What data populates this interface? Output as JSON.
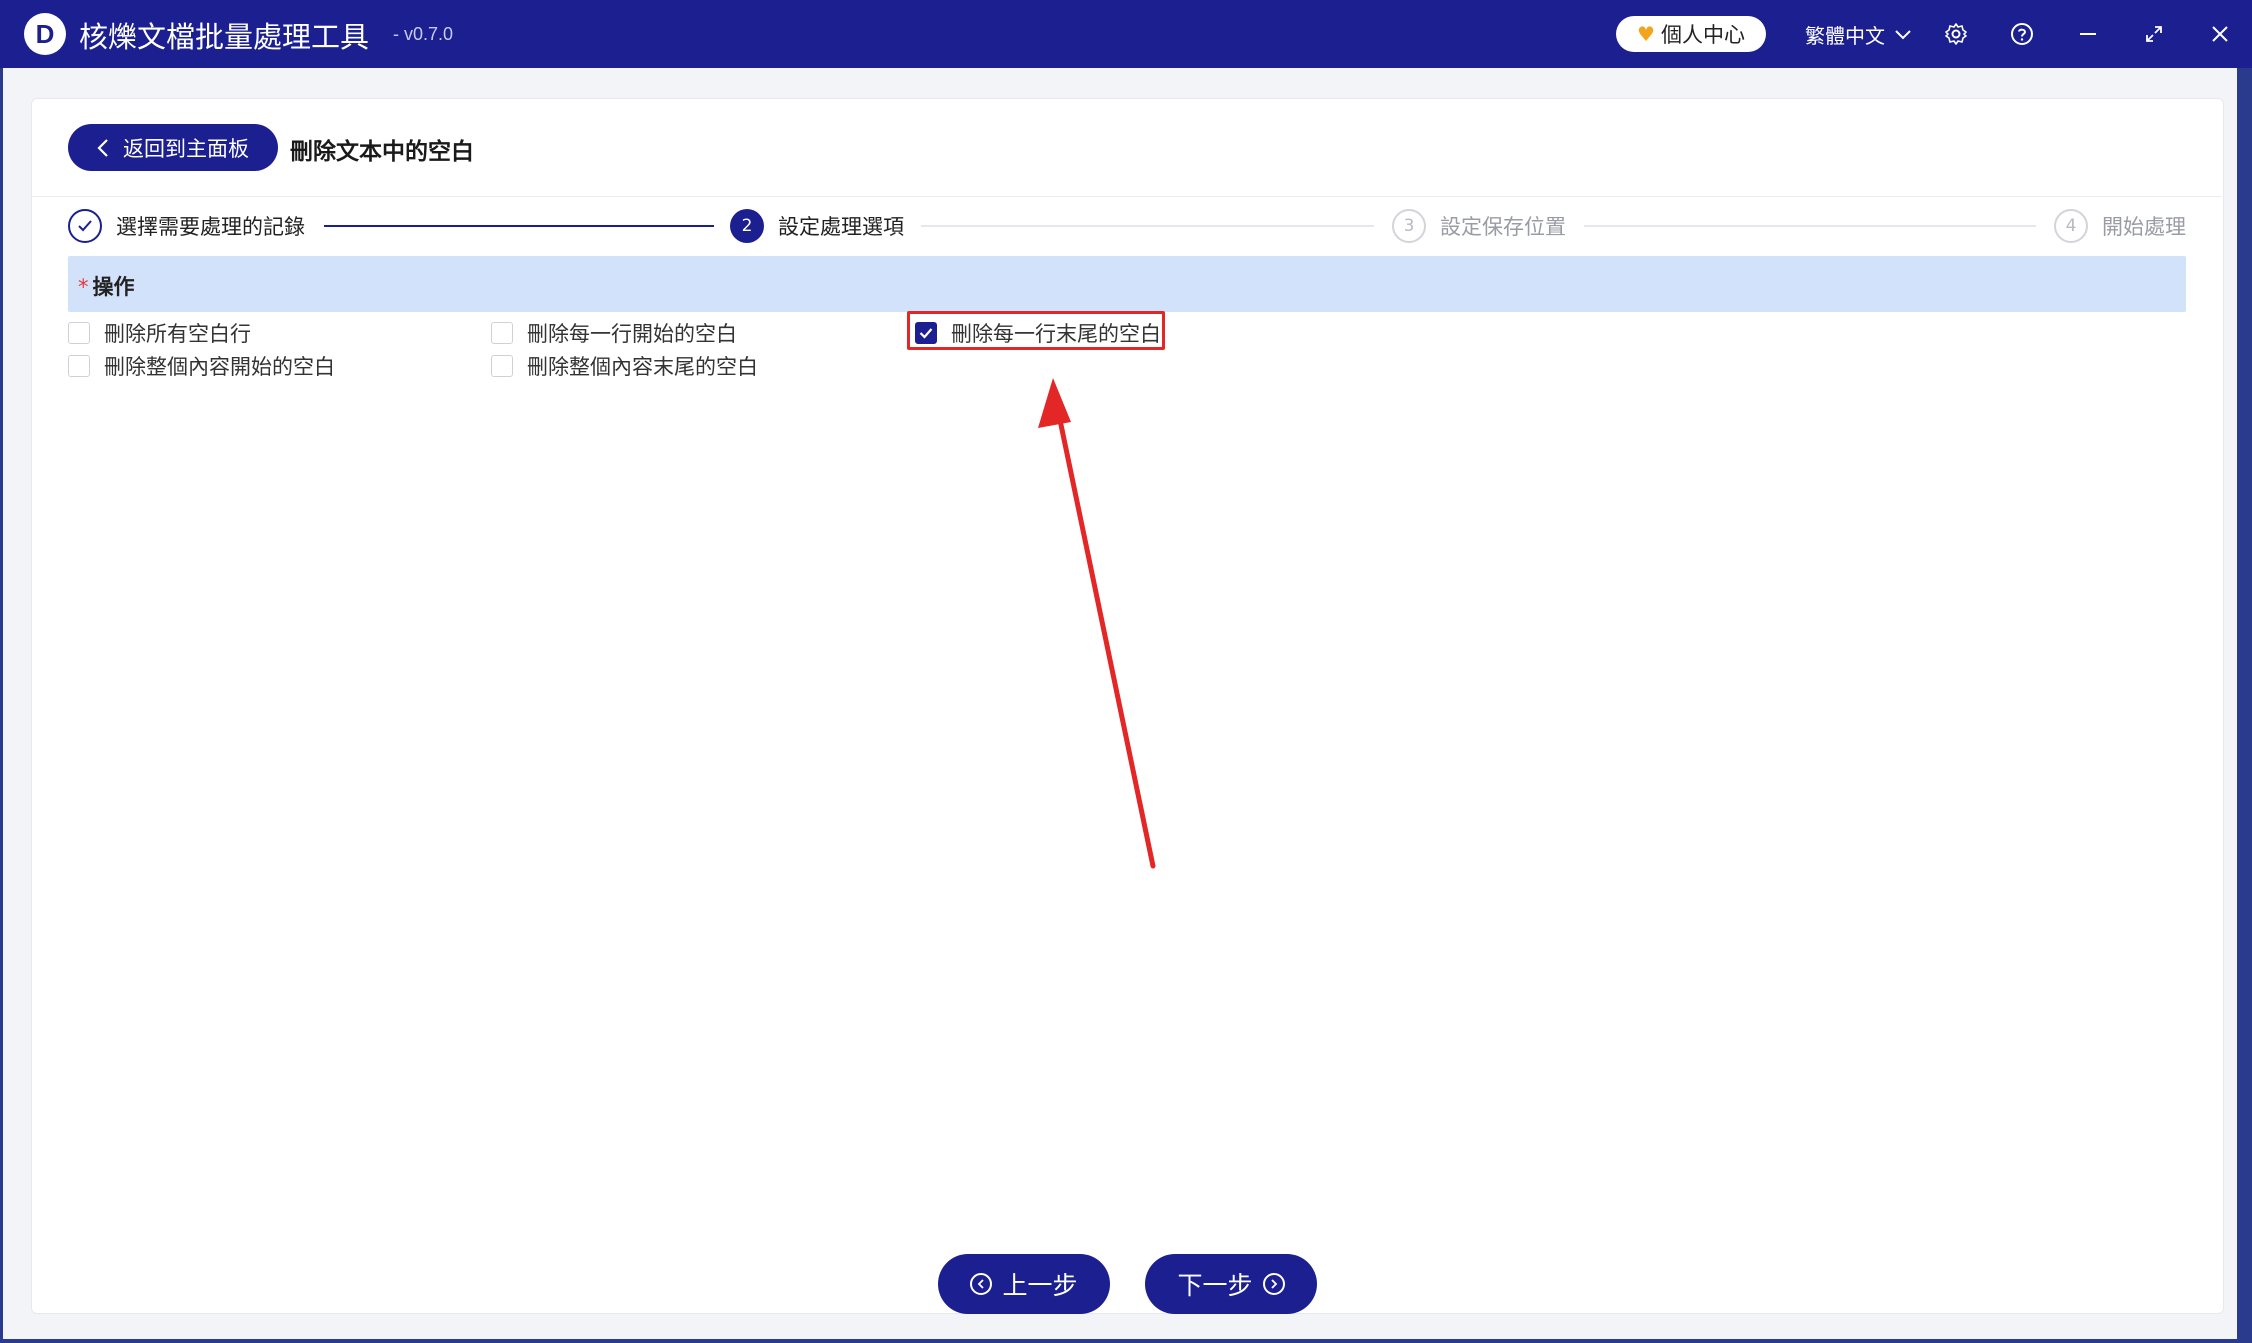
{
  "window": {
    "logo_letter": "D",
    "title": "核爍文檔批量處理工具",
    "version": "- v0.7.0",
    "vip_label": "個人中心",
    "language": "繁體中文",
    "icons": [
      "settings-icon",
      "help-icon",
      "minimize-icon",
      "maximize-icon",
      "close-icon"
    ]
  },
  "header": {
    "back_label": "返回到主面板",
    "page_title": "刪除文本中的空白"
  },
  "steps": [
    {
      "number": "✓",
      "label": "選擇需要處理的記錄",
      "state": "done"
    },
    {
      "number": "2",
      "label": "設定處理選項",
      "state": "active"
    },
    {
      "number": "3",
      "label": "設定保存位置",
      "state": "pending"
    },
    {
      "number": "4",
      "label": "開始處理",
      "state": "pending"
    }
  ],
  "section": {
    "required_mark": "*",
    "label": "操作"
  },
  "options": [
    {
      "label": "刪除所有空白行",
      "checked": false
    },
    {
      "label": "刪除每一行開始的空白",
      "checked": false
    },
    {
      "label": "刪除每一行末尾的空白",
      "checked": true
    },
    {
      "label": "刪除整個內容開始的空白",
      "checked": false
    },
    {
      "label": "刪除整個內容末尾的空白",
      "checked": false
    }
  ],
  "footer": {
    "prev_label": "上一步",
    "next_label": "下一步"
  },
  "colors": {
    "primary": "#1b1f8f",
    "section_bg": "#d3e2fb",
    "annotation": "#e32626"
  }
}
